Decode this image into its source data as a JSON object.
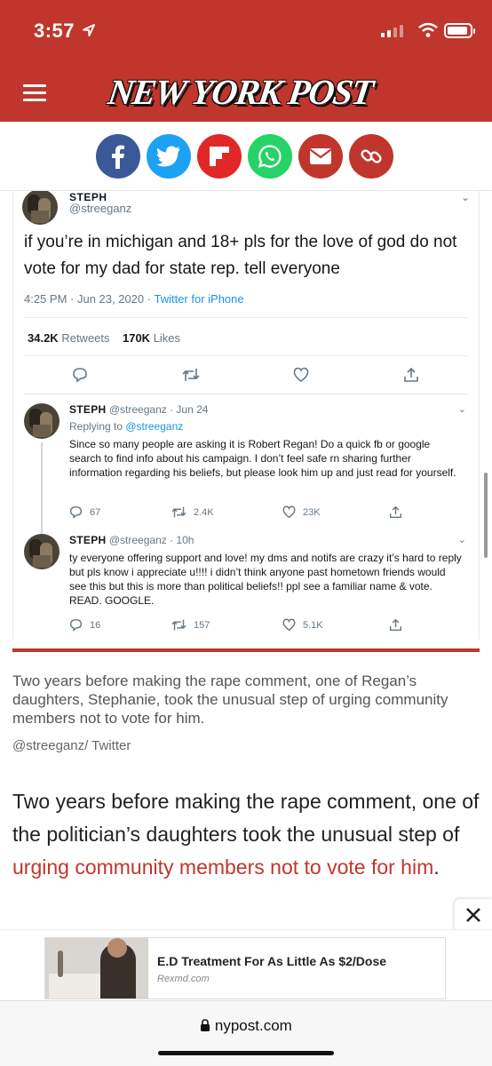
{
  "status": {
    "time": "3:57"
  },
  "header": {
    "logo": "NEW YORK POST"
  },
  "share": {
    "buttons": [
      {
        "name": "facebook",
        "color": "#3b5998"
      },
      {
        "name": "twitter",
        "color": "#1da1f2"
      },
      {
        "name": "flipboard",
        "color": "#e12828"
      },
      {
        "name": "whatsapp",
        "color": "#25d366"
      },
      {
        "name": "email",
        "color": "#c0362c"
      },
      {
        "name": "link",
        "color": "#c0362c"
      }
    ]
  },
  "tweet": {
    "name": "STEPH",
    "handle": "@streeganz",
    "text": "if you’re in michigan and 18+ pls for the love of god do not vote for my dad for state rep. tell everyone",
    "time": "4:25 PM · Jun 23, 2020 · ",
    "source": "Twitter for iPhone",
    "retweets": "34.2K",
    "retweets_label": "Retweets",
    "likes": "170K",
    "likes_label": "Likes"
  },
  "replies": [
    {
      "name": "STEPH",
      "meta": "@streeganz · Jun 24",
      "replying_prefix": "Replying to ",
      "replying_handle": "@streeganz",
      "text": "Since so many people are asking it is Robert Regan! Do a quick fb or google search to find info about his campaign. I don’t feel safe rn sharing further information regarding his beliefs, but please look him up and just read for yourself.",
      "replies_count": "67",
      "retweets_count": "2.4K",
      "likes_count": "23K"
    },
    {
      "name": "STEPH",
      "meta": "@streeganz · 10h",
      "text": "ty everyone offering support and love! my dms and notifs are crazy it’s hard to reply but pls know i appreciate u!!!! i didn’t think anyone past hometown friends would see this but this is more than political beliefs!! ppl see a familiar name & vote. READ. GOOGLE.",
      "replies_count": "16",
      "retweets_count": "157",
      "likes_count": "5.1K"
    }
  ],
  "article": {
    "caption": "Two years before making the rape comment, one of Regan’s daughters, Stephanie, took the unusual step of urging community members not to vote for him.",
    "credit": "@streeganz/ Twitter",
    "paragraph_start": "Two years before making the rape comment, one of the politician’s daughters took the unusual step of ",
    "paragraph_link": "urging community members not to vote for him",
    "paragraph_end": "."
  },
  "ad": {
    "title": "E.D Treatment For As Little As $2/Dose",
    "sponsor": "Rexmd.com"
  },
  "browser": {
    "url": "nypost.com"
  },
  "colors": {
    "brand_red": "#c0362c",
    "twitter_blue": "#1b95e0"
  }
}
